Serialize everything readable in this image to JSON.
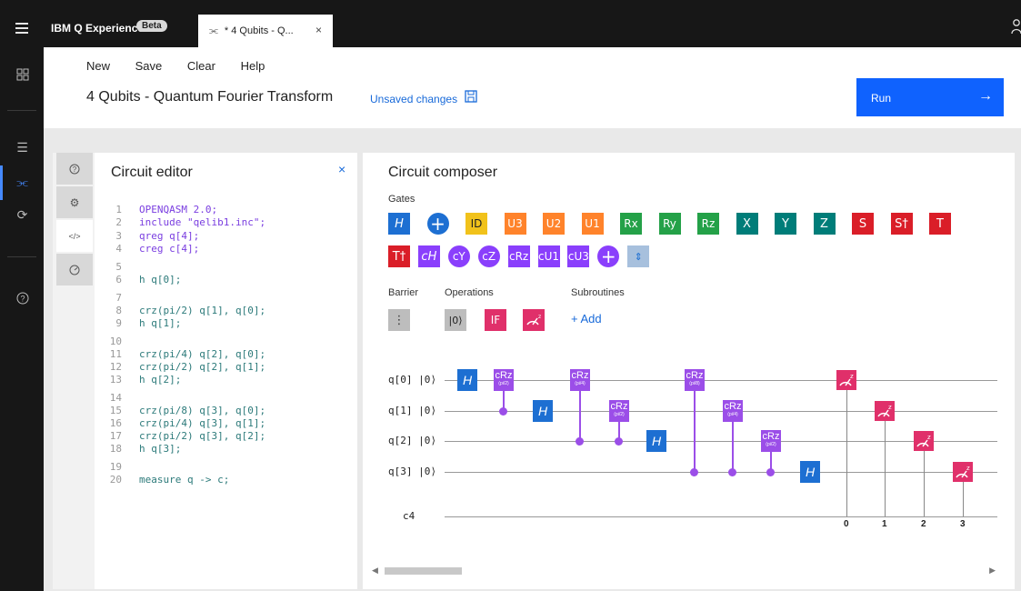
{
  "app": {
    "title": "IBM Q Experience",
    "badge": "Beta"
  },
  "tab": {
    "label": "* 4 Qubits - Q...",
    "close": "×"
  },
  "header": {
    "menu": [
      "New",
      "Save",
      "Clear",
      "Help"
    ],
    "title": "4 Qubits - Quantum Fourier Transform",
    "unsaved": "Unsaved changes",
    "run": "Run",
    "run_arrow": "→"
  },
  "editor": {
    "title": "Circuit editor",
    "close": "×",
    "lines": [
      {
        "n": "1",
        "t": "OPENQASM 2.0;"
      },
      {
        "n": "2",
        "t": "include \"qelib1.inc\";"
      },
      {
        "n": "3",
        "t": "qreg q[4];"
      },
      {
        "n": "4",
        "t": "creg c[4];"
      },
      {
        "n": "5",
        "t": ""
      },
      {
        "n": "6",
        "t": "h q[0];"
      },
      {
        "n": "7",
        "t": ""
      },
      {
        "n": "8",
        "t": "crz(pi/2) q[1], q[0];"
      },
      {
        "n": "9",
        "t": "h q[1];"
      },
      {
        "n": "10",
        "t": ""
      },
      {
        "n": "11",
        "t": "crz(pi/4) q[2], q[0];"
      },
      {
        "n": "12",
        "t": "crz(pi/2) q[2], q[1];"
      },
      {
        "n": "13",
        "t": "h q[2];"
      },
      {
        "n": "14",
        "t": ""
      },
      {
        "n": "15",
        "t": "crz(pi/8) q[3], q[0];"
      },
      {
        "n": "16",
        "t": "crz(pi/4) q[3], q[1];"
      },
      {
        "n": "17",
        "t": "crz(pi/2) q[3], q[2];"
      },
      {
        "n": "18",
        "t": "h q[3];"
      },
      {
        "n": "19",
        "t": ""
      },
      {
        "n": "20",
        "t": "measure q -> c;"
      }
    ]
  },
  "composer": {
    "title": "Circuit composer",
    "gates_label": "Gates",
    "barrier_label": "Barrier",
    "operations_label": "Operations",
    "subroutines_label": "Subroutines",
    "add": "+ Add",
    "gates": [
      {
        "label": "H",
        "color": "#1d6fd2"
      },
      {
        "label": "+",
        "color": "#1d6fd2"
      },
      {
        "label": "ID",
        "color": "#f1c21b"
      },
      {
        "label": "U3",
        "color": "#ff832b"
      },
      {
        "label": "U2",
        "color": "#ff832b"
      },
      {
        "label": "U1",
        "color": "#ff832b"
      },
      {
        "label": "Rx",
        "color": "#24a148"
      },
      {
        "label": "Ry",
        "color": "#24a148"
      },
      {
        "label": "Rz",
        "color": "#24a148"
      },
      {
        "label": "X",
        "color": "#007d79"
      },
      {
        "label": "Y",
        "color": "#007d79"
      },
      {
        "label": "Z",
        "color": "#007d79"
      },
      {
        "label": "S",
        "color": "#da1e28"
      },
      {
        "label": "S†",
        "color": "#da1e28"
      },
      {
        "label": "T",
        "color": "#da1e28"
      },
      {
        "label": "T†",
        "color": "#da1e28"
      },
      {
        "label": "cH",
        "color": "#8a3ffc"
      },
      {
        "label": "cY",
        "color": "#8a3ffc"
      },
      {
        "label": "cZ",
        "color": "#8a3ffc"
      },
      {
        "label": "cRz",
        "color": "#8a3ffc"
      },
      {
        "label": "cU1",
        "color": "#8a3ffc"
      },
      {
        "label": "cU3",
        "color": "#8a3ffc"
      },
      {
        "label": "+",
        "color": "#8a3ffc"
      },
      {
        "label": "swap",
        "color": "#a7c0dd"
      }
    ],
    "operations": [
      {
        "label": "|0⟩",
        "color": "#bdbdbd"
      },
      {
        "label": "IF",
        "color": "#e0306a"
      }
    ],
    "qubits": [
      "q[0]  |0⟩",
      "q[1]  |0⟩",
      "q[2]  |0⟩",
      "q[3]  |0⟩"
    ],
    "classical": "c4",
    "h_label": "H",
    "crz_label": "cRz",
    "crz_params": [
      "(pi/2)",
      "(pi/4)",
      "(pi/8)"
    ],
    "measure_indices": [
      "0",
      "1",
      "2",
      "3"
    ]
  }
}
